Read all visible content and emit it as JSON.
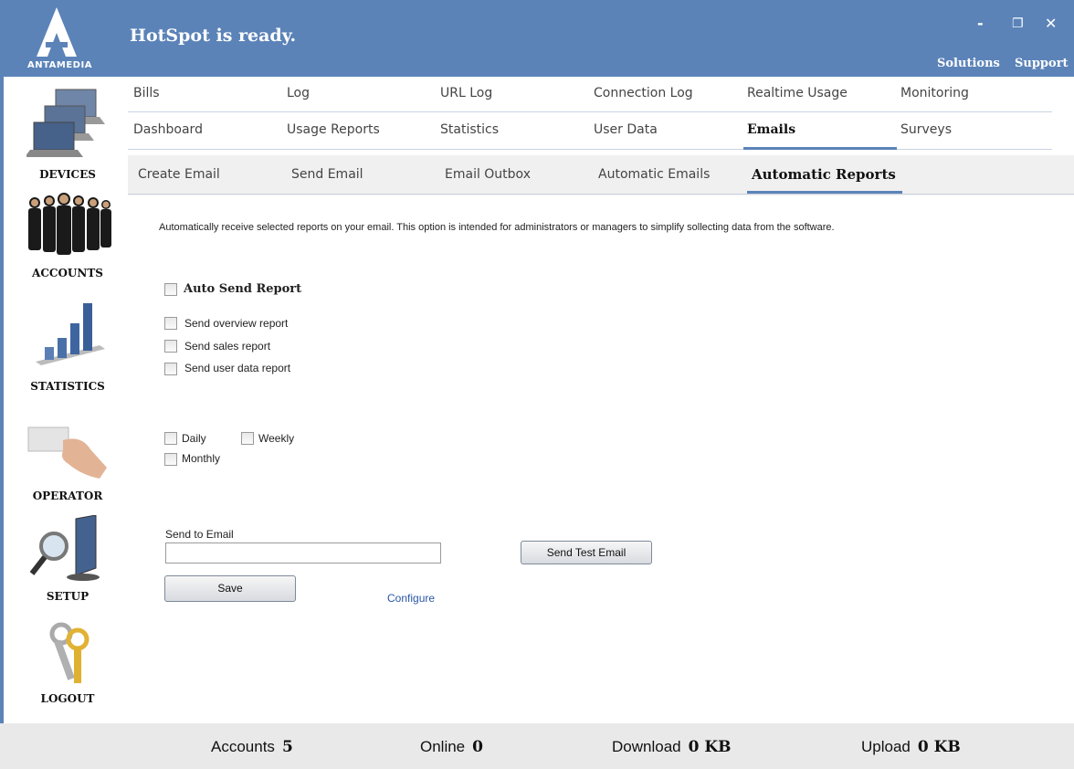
{
  "header": {
    "status": "HotSpot is ready.",
    "logo_text": "ANTAMEDIA",
    "minimize_glyph": "-",
    "restore_glyph": "❐",
    "close_glyph": "✕",
    "links": [
      "Solutions",
      "Support"
    ],
    "bg_color": "#5b83b8"
  },
  "sidebar": {
    "items": [
      {
        "label": "DEVICES",
        "icon": "laptops-icon"
      },
      {
        "label": "ACCOUNTS",
        "icon": "people-icon"
      },
      {
        "label": "STATISTICS",
        "icon": "bar-chart-icon"
      },
      {
        "label": "OPERATOR",
        "icon": "hand-card-icon"
      },
      {
        "label": "SETUP",
        "icon": "monitor-magnifier-icon"
      },
      {
        "label": "LOGOUT",
        "icon": "keys-icon"
      }
    ]
  },
  "nav": {
    "row1": [
      "Bills",
      "Log",
      "URL Log",
      "Connection Log",
      "Realtime Usage",
      "Monitoring"
    ],
    "row2": [
      "Dashboard",
      "Usage Reports",
      "Statistics",
      "User Data",
      "Emails",
      "Surveys"
    ],
    "active": "Emails",
    "sub": [
      "Create Email",
      "Send Email",
      "Email Outbox",
      "Automatic Emails",
      "Automatic Reports"
    ],
    "sub_active": "Automatic Reports"
  },
  "content": {
    "description": "Automatically receive selected reports on your email. This option is intended for administrators or managers to simplify sollecting data from the software.",
    "auto_send": {
      "label": "Auto Send Report",
      "checked": false
    },
    "reports": [
      {
        "label": "Send overview report",
        "checked": false
      },
      {
        "label": "Send sales report",
        "checked": false
      },
      {
        "label": "Send user data report",
        "checked": false
      }
    ],
    "frequency": [
      {
        "label": "Daily",
        "checked": false
      },
      {
        "label": "Weekly",
        "checked": false
      },
      {
        "label": "Monthly",
        "checked": false
      }
    ],
    "email_label": "Send to Email",
    "email_value": "",
    "send_test_label": "Send Test Email",
    "save_label": "Save",
    "configure_label": "Configure"
  },
  "footer": {
    "accounts_label": "Accounts",
    "accounts_value": "5",
    "online_label": "Online",
    "online_value": "0",
    "download_label": "Download",
    "download_value": "0 KB",
    "upload_label": "Upload",
    "upload_value": "0 KB"
  }
}
